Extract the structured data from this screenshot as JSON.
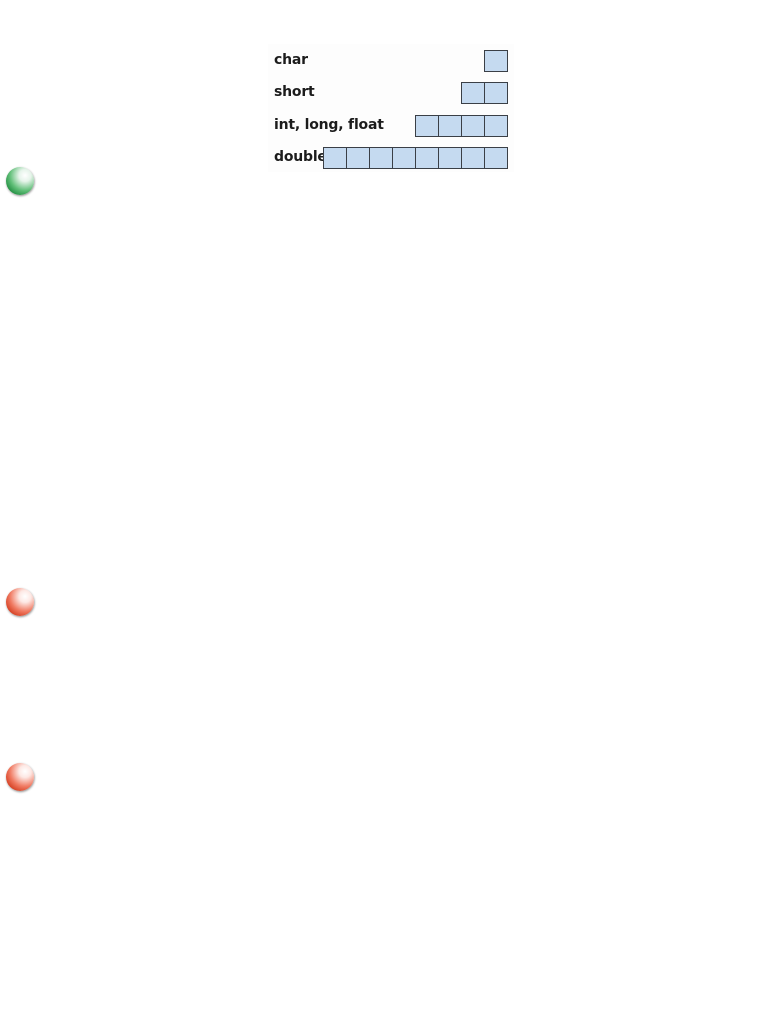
{
  "diagram": {
    "rows": [
      {
        "label": "char",
        "bytes": 1
      },
      {
        "label": "short",
        "bytes": 2
      },
      {
        "label": "int, long, float",
        "bytes": 4
      },
      {
        "label": "double",
        "bytes": 8
      }
    ],
    "box_color": "#c5daf0",
    "box_border_color": "#3a3f46"
  },
  "bullets": [
    {
      "icon": "green-sphere-icon",
      "color": "#1c8a3c"
    },
    {
      "icon": "red-sphere-icon",
      "color": "#d23a1c"
    },
    {
      "icon": "red-sphere-icon",
      "color": "#d23a1c"
    }
  ]
}
